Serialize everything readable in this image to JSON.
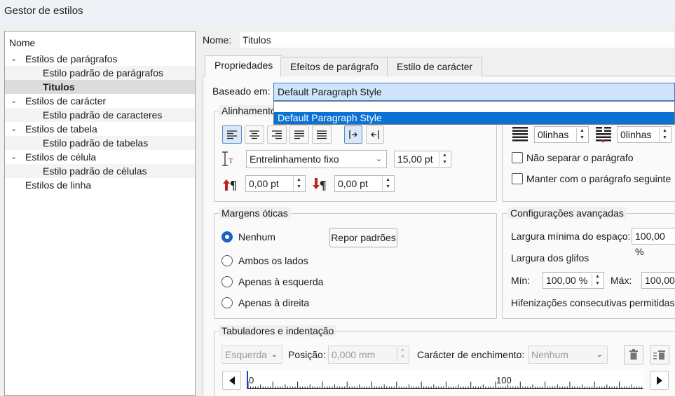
{
  "window": {
    "title": "Gestor de estilos"
  },
  "tree": {
    "header": "Nome",
    "items": [
      {
        "label": "Estilos de parágrafos",
        "level": 0,
        "expanded": true
      },
      {
        "label": "Estilo padrão de parágrafos",
        "level": 1
      },
      {
        "label": "Titulos",
        "level": 1,
        "selected": true
      },
      {
        "label": "Estilos de carácter",
        "level": 0,
        "expanded": true
      },
      {
        "label": "Estilo padrão de caracteres",
        "level": 1
      },
      {
        "label": "Estilos de tabela",
        "level": 0,
        "expanded": true
      },
      {
        "label": "Estilo padrão de tabelas",
        "level": 1
      },
      {
        "label": "Estilos de célula",
        "level": 0,
        "expanded": true
      },
      {
        "label": "Estilo padrão de células",
        "level": 1
      },
      {
        "label": "Estilos de linha",
        "level": 0
      }
    ]
  },
  "name": {
    "label": "Nome:",
    "value": "Titulos"
  },
  "tabs": [
    {
      "label": "Propriedades",
      "active": true
    },
    {
      "label": "Efeitos de parágrafo"
    },
    {
      "label": "Estilo de carácter"
    }
  ],
  "based_on": {
    "label": "Baseado em:",
    "value": "Default Paragraph Style",
    "dropdown_options": [
      "Default Paragraph Style"
    ]
  },
  "alignment": {
    "title": "Alinhamento",
    "buttons": [
      "align-left-icon",
      "align-center-icon",
      "align-right-icon",
      "align-justify-icon",
      "align-force-justify-icon",
      "direction-ltr-icon",
      "direction-rtl-icon"
    ],
    "line_spacing_mode": "Entrelinhamento fixo",
    "line_spacing_value": "15,00 pt",
    "space_above": "0,00 pt",
    "space_below": "0,00 pt"
  },
  "drop_caps": {
    "lines_1": "0linhas",
    "lines_2": "0linhas",
    "no_split": "Não separar o parágrafo",
    "keep_with_next": "Manter com o parágrafo seguinte"
  },
  "optical_margins": {
    "title": "Margens óticas",
    "options": [
      "Nenhum",
      "Ambos os lados",
      "Apenas à esquerda",
      "Apenas à direita"
    ],
    "selected": "Nenhum",
    "reset_button": "Repor padrões"
  },
  "advanced": {
    "title": "Configurações avançadas",
    "min_space_label": "Largura mínima do espaço:",
    "min_space_value": "100,00  %",
    "glyph_width_label": "Largura dos glifos",
    "min_label": "Mín:",
    "min_value": "100,00  %",
    "max_label": "Máx:",
    "max_value": "100,00",
    "hyphen_label": "Hifenizações consecutivas permitidas:"
  },
  "tabs_indent": {
    "title": "Tabuladores e indentação",
    "align_value": "Esquerda",
    "position_label": "Posição:",
    "position_value": "0,000 mm",
    "fill_label": "Carácter de enchimento:",
    "fill_value": "Nenhum",
    "ruler_start": "0",
    "ruler_mid": "100"
  },
  "colors": {
    "accent": "#1a64c8",
    "selection": "#0b72d4",
    "combo_bg": "#cfe3fb"
  }
}
